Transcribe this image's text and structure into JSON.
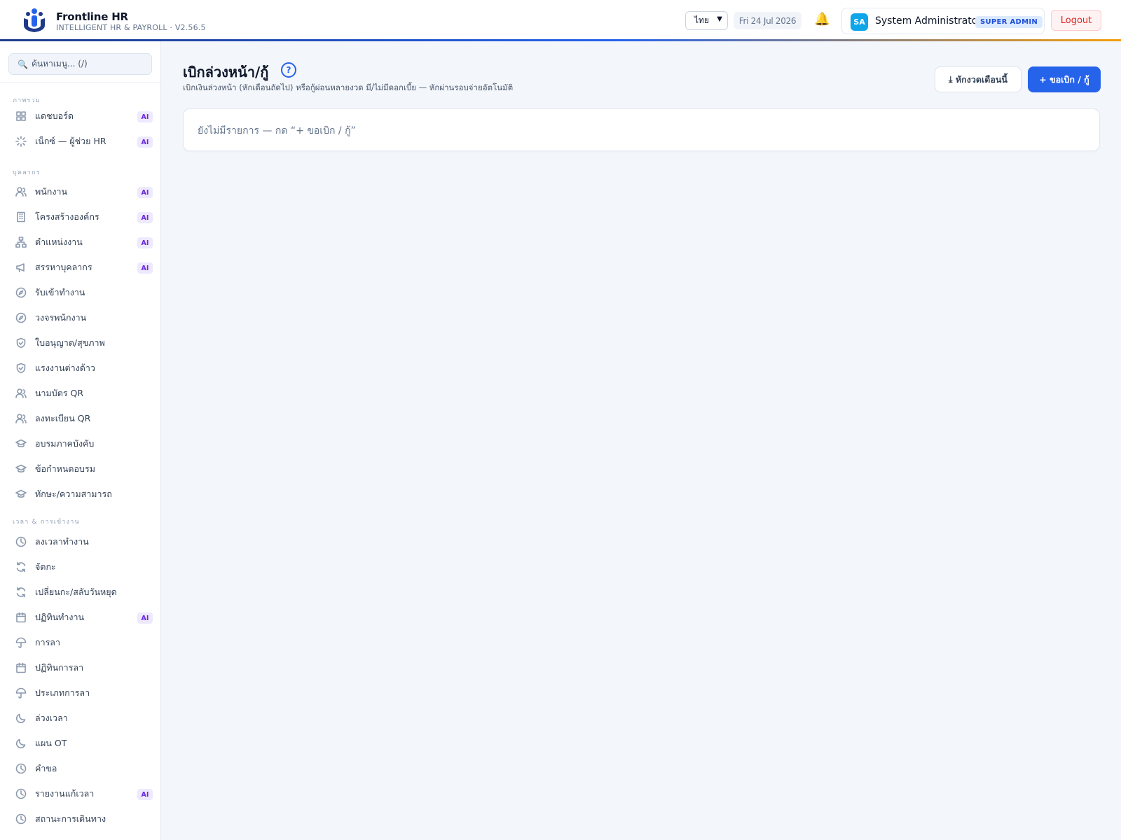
{
  "header": {
    "brand_title": "Frontline HR",
    "brand_subtitle": "INTELLIGENT HR & PAYROLL · V2.56.5",
    "language": "ไทย",
    "date": "Fri 24 Jul 2026",
    "user_initials": "SA",
    "user_name": "System Administrator",
    "user_role": "SUPER ADMIN",
    "logout_label": "Logout"
  },
  "sidebar": {
    "search_placeholder": "ค้นหาเมนู... (/)",
    "sections": {
      "overview": "ภาพรวม",
      "personnel": "บุคลากร",
      "time": "เวลา & การเข้างาน"
    },
    "items": [
      {
        "label": "แดชบอร์ด",
        "icon": "grid-icon",
        "ai": "AI"
      },
      {
        "label": "เน็กซ์ — ผู้ช่วย HR",
        "icon": "sparkle-icon",
        "ai": "AI"
      },
      {
        "label": "พนักงาน",
        "icon": "users-icon",
        "ai": "AI"
      },
      {
        "label": "โครงสร้างองค์กร",
        "icon": "building-icon",
        "ai": "AI"
      },
      {
        "label": "ตำแหน่งงาน",
        "icon": "org-chart-icon",
        "ai": "AI"
      },
      {
        "label": "สรรหาบุคลากร",
        "icon": "megaphone-icon",
        "ai": "AI"
      },
      {
        "label": "รับเข้าทำงาน",
        "icon": "compass-icon"
      },
      {
        "label": "วงจรพนักงาน",
        "icon": "compass-icon"
      },
      {
        "label": "ใบอนุญาต/สุขภาพ",
        "icon": "shield-icon"
      },
      {
        "label": "แรงงานต่างด้าว",
        "icon": "shield-icon"
      },
      {
        "label": "นามบัตร QR",
        "icon": "users-icon"
      },
      {
        "label": "ลงทะเบียน QR",
        "icon": "users-icon"
      },
      {
        "label": "อบรมภาคบังคับ",
        "icon": "graduation-cap-icon"
      },
      {
        "label": "ข้อกำหนดอบรม",
        "icon": "graduation-cap-icon"
      },
      {
        "label": "ทักษะ/ความสามารถ",
        "icon": "graduation-cap-icon"
      },
      {
        "label": "ลงเวลาทำงาน",
        "icon": "clock-icon"
      },
      {
        "label": "จัดกะ",
        "icon": "refresh-icon"
      },
      {
        "label": "เปลี่ยนกะ/สลับวันหยุด",
        "icon": "refresh-icon"
      },
      {
        "label": "ปฏิทินทำงาน",
        "icon": "calendar-icon",
        "ai": "AI"
      },
      {
        "label": "การลา",
        "icon": "umbrella-icon"
      },
      {
        "label": "ปฏิทินการลา",
        "icon": "calendar-icon"
      },
      {
        "label": "ประเภทการลา",
        "icon": "umbrella-icon"
      },
      {
        "label": "ล่วงเวลา",
        "icon": "moon-icon"
      },
      {
        "label": "แผน OT",
        "icon": "moon-icon"
      },
      {
        "label": "คำขอ",
        "icon": "clock-icon"
      },
      {
        "label": "รายงานแก้เวลา",
        "icon": "clock-icon",
        "ai": "AI"
      },
      {
        "label": "สถานะการเดินทาง",
        "icon": "clock-icon"
      }
    ]
  },
  "main": {
    "title": "เบิกล่วงหน้า/กู้",
    "help": "?",
    "subtitle": "เบิกเงินล่วงหน้า (หักเดือนถัดไป) หรือกู้ผ่อนหลายงวด มี/ไม่มีดอกเบี้ย — หักผ่านรอบจ่ายอัตโนมัติ",
    "deduct_button": "⤓ หักงวดเดือนนี้",
    "request_button": "+ ขอเบิก / กู้",
    "empty_message": "ยังไม่มีรายการ — กด “+ ขอเบิก / กู้”"
  }
}
